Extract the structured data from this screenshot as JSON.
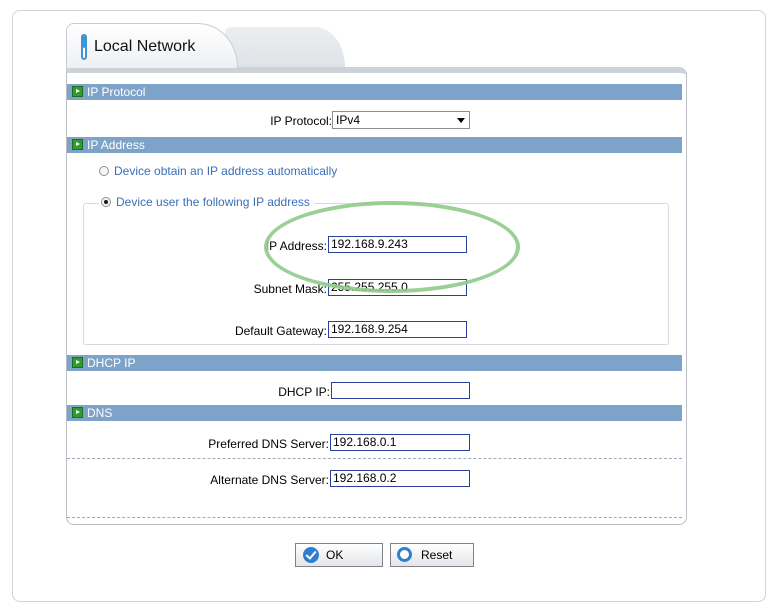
{
  "tab": {
    "title": "Local Network"
  },
  "sections": {
    "ip_protocol": "IP Protocol",
    "ip_address": "IP Address",
    "dhcp_ip": "DHCP IP",
    "dns": "DNS"
  },
  "ip_protocol": {
    "label": "IP Protocol:",
    "selected": "IPv4"
  },
  "ip_mode": {
    "auto_label": "Device obtain an IP address automatically",
    "manual_label": "Device user the following IP address",
    "selected": "manual"
  },
  "fields": {
    "ip_address": {
      "label": "IP Address:",
      "value": "192.168.9.243"
    },
    "subnet_mask": {
      "label": "Subnet Mask:",
      "value": "255.255.255.0"
    },
    "default_gateway": {
      "label": "Default Gateway:",
      "value": "192.168.9.254"
    },
    "dhcp_ip": {
      "label": "DHCP IP:",
      "value": ""
    },
    "preferred_dns": {
      "label": "Preferred DNS Server:",
      "value": "192.168.0.1"
    },
    "alternate_dns": {
      "label": "Alternate DNS Server:",
      "value": "192.168.0.2"
    }
  },
  "buttons": {
    "ok": "OK",
    "reset": "Reset"
  },
  "colors": {
    "section_header": "#7ea3c8",
    "radio_text": "#3a6fb7",
    "highlight": "#8fca8b",
    "accent": "#2f7fd0"
  },
  "icons": {
    "section_marker": "green-arrow-icon",
    "tab_marker": "tab-pill-icon",
    "ok_button": "checkmark-icon",
    "reset_button": "circle-icon"
  }
}
